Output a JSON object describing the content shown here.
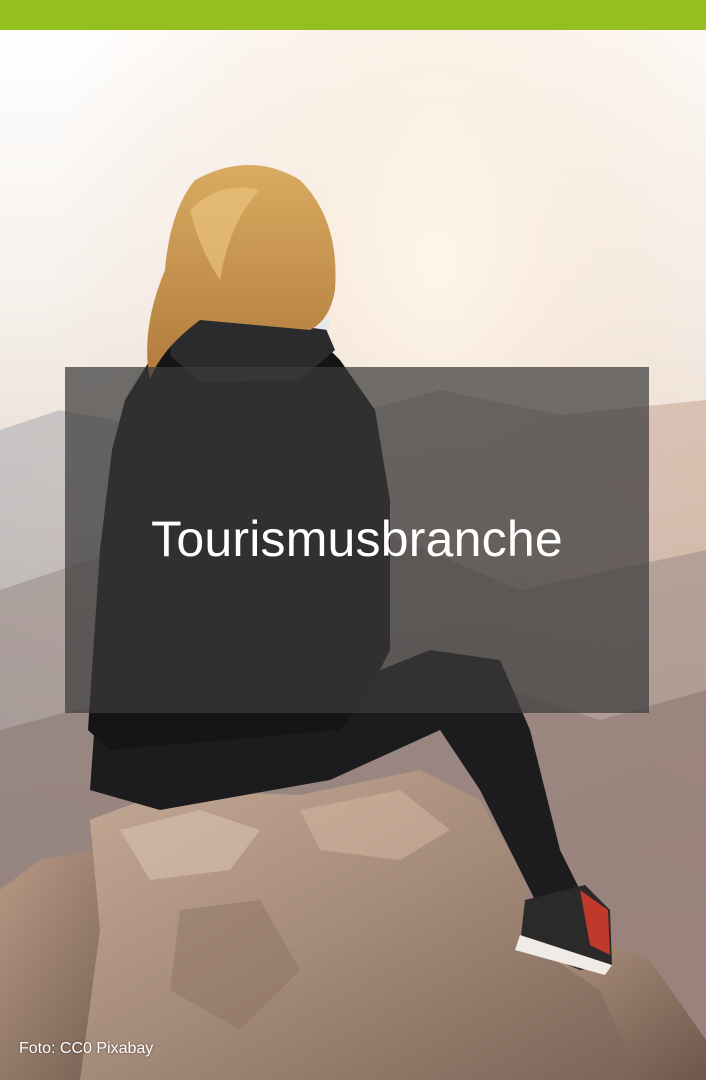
{
  "header": {
    "accent_color": "#93c01f"
  },
  "hero": {
    "title": "Tourismusbranche",
    "image_subject": "woman-sitting-on-rock-at-sunrise",
    "credit": "Foto: CC0 Pixabay"
  }
}
